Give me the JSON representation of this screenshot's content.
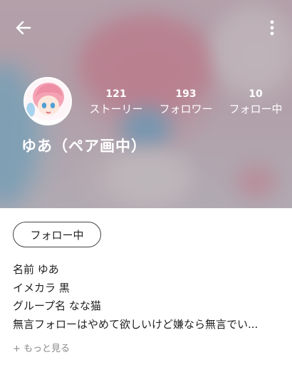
{
  "profile": {
    "display_name": "ゆあ（ペア画中）",
    "stats": [
      {
        "value": "121",
        "label": "ストーリー"
      },
      {
        "value": "193",
        "label": "フォロワー"
      },
      {
        "value": "10",
        "label": "フォロー中"
      }
    ],
    "follow_button_label": "フォロー中",
    "bio_lines": [
      "名前 ゆあ",
      "イメカラ 黒",
      "グループ名 なな猫",
      "無言フォローはやめて欲しいけど嫌なら無言でい..."
    ],
    "more_label": "+ もっと見る"
  },
  "icons": {
    "back": "arrow-left-icon",
    "menu": "more-vertical-icon"
  },
  "colors": {
    "header_text": "#ffffff",
    "button_border": "#444444",
    "muted_text": "#8a8a8a"
  }
}
